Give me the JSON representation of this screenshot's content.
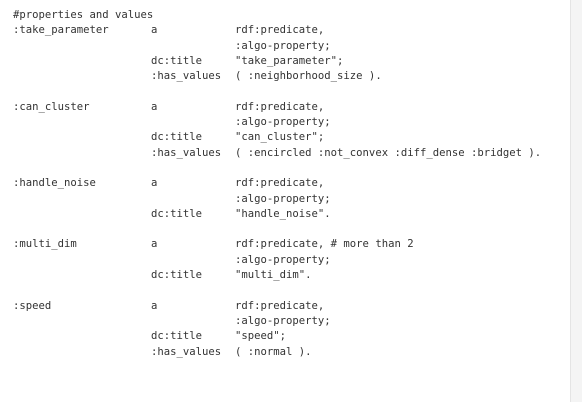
{
  "code": {
    "comment": "#properties and values",
    "blocks": [
      {
        "subject": ":take_parameter",
        "rows": [
          {
            "pred": "a",
            "obj": "rdf:predicate,"
          },
          {
            "obj": ":algo-property;"
          },
          {
            "pred": "dc:title",
            "obj": "\"take_parameter\";"
          },
          {
            "pred": ":has_values",
            "obj": "( :neighborhood_size )."
          }
        ]
      },
      {
        "subject": ":can_cluster",
        "rows": [
          {
            "pred": "a",
            "obj": "rdf:predicate,"
          },
          {
            "obj": ":algo-property;"
          },
          {
            "pred": "dc:title",
            "obj": "\"can_cluster\";"
          },
          {
            "pred": ":has_values",
            "obj": "( :encircled :not_convex :diff_dense :bridget )."
          }
        ]
      },
      {
        "subject": ":handle_noise",
        "rows": [
          {
            "pred": "a",
            "obj": "rdf:predicate,"
          },
          {
            "obj": ":algo-property;"
          },
          {
            "pred": "dc:title",
            "obj": "\"handle_noise\"."
          }
        ]
      },
      {
        "subject": ":multi_dim",
        "rows": [
          {
            "pred": "a",
            "obj": "rdf:predicate, # more than 2"
          },
          {
            "obj": ":algo-property;"
          },
          {
            "pred": "dc:title",
            "obj": "\"multi_dim\"."
          }
        ]
      },
      {
        "subject": ":speed",
        "rows": [
          {
            "pred": "a",
            "obj": "rdf:predicate,"
          },
          {
            "obj": ":algo-property;"
          },
          {
            "pred": "dc:title",
            "obj": "\"speed\";"
          },
          {
            "pred": ":has_values",
            "obj": "( :normal )."
          }
        ]
      }
    ]
  }
}
